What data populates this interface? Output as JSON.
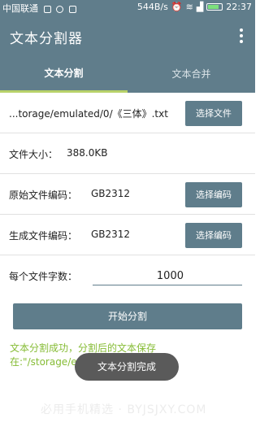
{
  "status_bar": {
    "carrier": "中国联通",
    "speed": "544B/s",
    "time": "22:37"
  },
  "app_bar": {
    "title": "文本分割器"
  },
  "tabs": [
    {
      "label": "文本分割",
      "active": true
    },
    {
      "label": "文本合并",
      "active": false
    }
  ],
  "file_row": {
    "path": "...torage/emulated/0/《三体》.txt",
    "button": "选择文件"
  },
  "size_row": {
    "label": "文件大小：",
    "value": "388.0KB"
  },
  "orig_row": {
    "label": "原始文件编码：",
    "value": "GB2312",
    "button": "选择编码"
  },
  "gen_row": {
    "label": "生成文件编码：",
    "value": "GB2312",
    "button": "选择编码"
  },
  "count_row": {
    "label": "每个文件字数：",
    "value": "1000"
  },
  "start_button": "开始分割",
  "success_text": "文本分割成功，分割后的文本保存在:\"/storage/emulated/0/...",
  "toast": "文本分割完成",
  "watermark": "必用手机精选 · BYJSJXY.COM",
  "colors": {
    "primary": "#607d8b",
    "button": "#5f7d8b",
    "tab_indicator": "#b8d26a",
    "success_text": "#86bc36",
    "toast_bg": "#5a5a5a"
  }
}
